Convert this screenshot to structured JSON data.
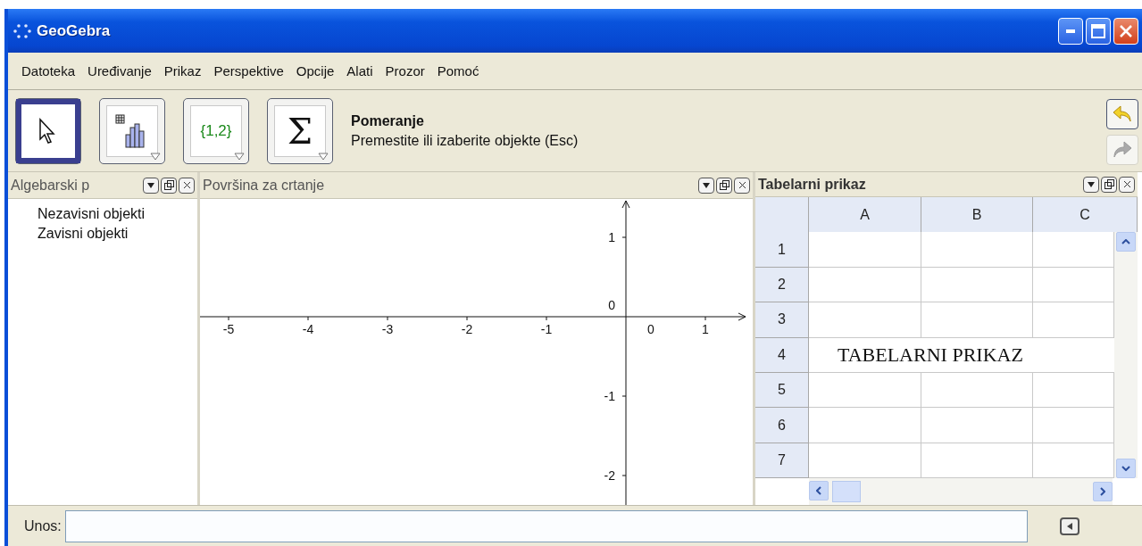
{
  "window": {
    "title": "GeoGebra"
  },
  "menu": [
    "Datoteka",
    "Uređivanje",
    "Prikaz",
    "Perspektive",
    "Opcije",
    "Alati",
    "Prozor",
    "Pomoć"
  ],
  "toolbar": {
    "tools": [
      {
        "kind": "pointer",
        "selected": true
      },
      {
        "kind": "chart",
        "selected": false
      },
      {
        "kind": "list",
        "label": "{1,2}",
        "selected": false
      },
      {
        "kind": "sum",
        "label": "Σ",
        "selected": false
      }
    ],
    "tool_name": "Pomeranje",
    "tool_help": "Premestite ili izaberite objekte (Esc)",
    "undo": {
      "disabled": false
    },
    "redo": {
      "disabled": true
    }
  },
  "algebra": {
    "title": "Algebarski p",
    "items": [
      "Nezavisni objekti",
      "Zavisni objekti"
    ]
  },
  "graphics": {
    "title": "Površina za crtanje",
    "x_ticks": [
      "-5",
      "-4",
      "-3",
      "-2",
      "-1",
      "0",
      "1"
    ],
    "y_ticks": [
      "1",
      "0",
      "-1",
      "-2"
    ]
  },
  "spreadsheet": {
    "title": "Tabelarni prikaz",
    "columns": [
      "A",
      "B",
      "C"
    ],
    "rows": [
      {
        "label": "1"
      },
      {
        "label": "2"
      },
      {
        "label": "3"
      },
      {
        "label": "4",
        "text": "TABELARNI PRIKAZ"
      },
      {
        "label": "5"
      },
      {
        "label": "6"
      },
      {
        "label": "7"
      }
    ]
  },
  "input_bar": {
    "label": "Unos:"
  }
}
